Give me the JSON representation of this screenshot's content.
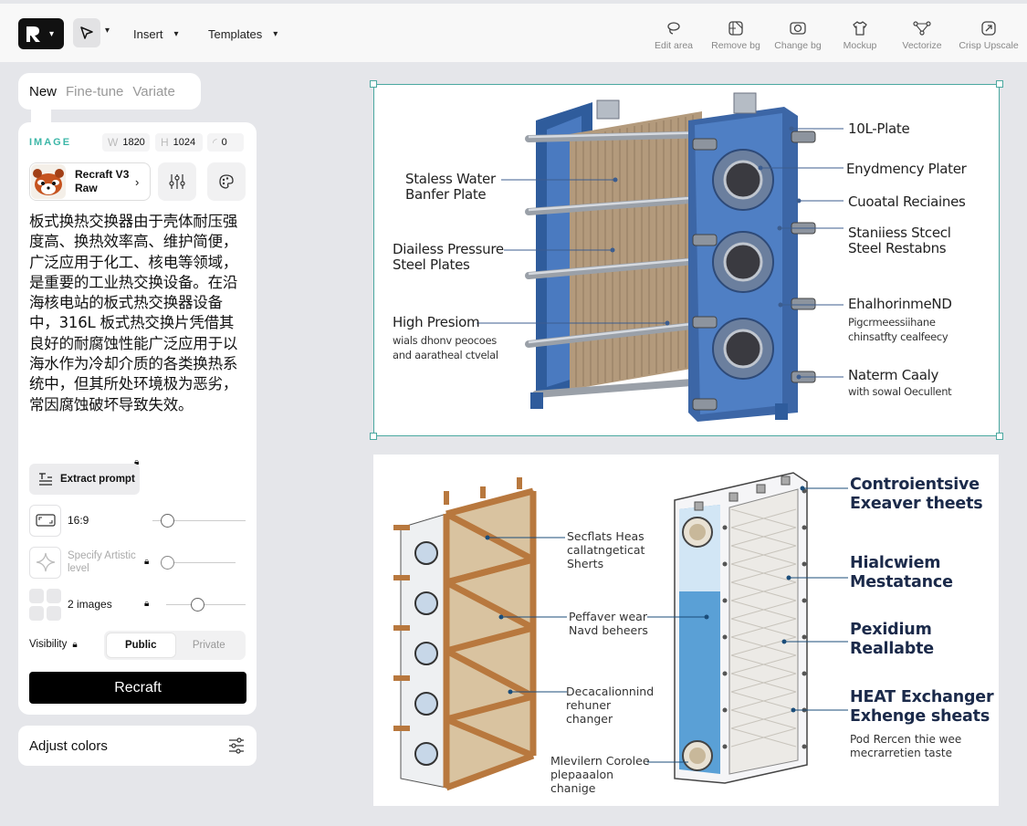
{
  "toolbar": {
    "menu": [
      {
        "label": "Insert"
      },
      {
        "label": "Templates"
      }
    ],
    "tools": [
      {
        "label": "Edit area",
        "icon": "lasso-icon"
      },
      {
        "label": "Remove bg",
        "icon": "remove-bg-icon"
      },
      {
        "label": "Change bg",
        "icon": "change-bg-icon"
      },
      {
        "label": "Mockup",
        "icon": "shirt-icon"
      },
      {
        "label": "Vectorize",
        "icon": "vectorize-icon"
      },
      {
        "label": "Crisp Upscale",
        "icon": "upscale-icon"
      }
    ]
  },
  "panel": {
    "tabs": [
      "New",
      "Fine-tune",
      "Variate"
    ],
    "image_label": "IMAGE",
    "width_key": "W",
    "width": "1820",
    "height_key": "H",
    "height": "1024",
    "seed": "0",
    "model_name": "Recraft V3 Raw",
    "prompt": "板式换热交换器由于壳体耐压强度高、换热效率高、维护简便，广泛应用于化工、核电等领域，是重要的工业热交换设备。在沿海核电站的板式热交换器设备中，316L 板式热交换片凭借其良好的耐腐蚀性能广泛应用于以海水作为冷却介质的各类换热系统中，但其所处环境极为恶劣，常因腐蚀破坏导致失效。",
    "extract_label": "Extract prompt",
    "aspect_label": "16:9",
    "artistic_label": "Specify Artistic level",
    "images_label": "2 images",
    "visibility_label": "Visibility",
    "visibility_options": [
      "Public",
      "Private"
    ],
    "recraft_label": "Recraft",
    "adjust_label": "Adjust colors"
  },
  "image1": {
    "labels": {
      "l1": "Staless Water Banfer Plate",
      "l2": "Diailess Pressure Steel Plates",
      "l3": "High Presiom",
      "l3s": "wials dhonv peocoes and aaratheal ctvelal",
      "r1": "10L-Plate",
      "r2": "Enydmency Plater",
      "r3": "Cuoatal Reciaines",
      "r4": "Staniiess Stcecl Steel Restabns",
      "r5": "EhalhorinmeND",
      "r5s": "Pigcrmeessiihane chinsatfty cealfeecy",
      "r6": "Naterm Caaly",
      "r6s": "with sowal Oecullent"
    }
  },
  "image2": {
    "labels": {
      "c1": "Secflats Heas callatngeticat Sherts",
      "c2": "Peffaver wear Navd beheers",
      "c3": "Decacalionnind rehuner changer",
      "c4": "Mlevilern Corolee plepaaalon chanige",
      "r1": "Controientsive Exeaver theets",
      "r2": "Hialcwiem Mestatance",
      "r3": "Pexidium Reallabte",
      "r4": "HEAT Exchanger Exhenge sheats",
      "r4s": "Pod Rercen thie wee mecrarretien taste"
    }
  },
  "colors": {
    "accent": "#3db7a8",
    "selection": "#4aa8a0",
    "frame_blue": "#3c66a6",
    "wood": "#b8783e"
  }
}
